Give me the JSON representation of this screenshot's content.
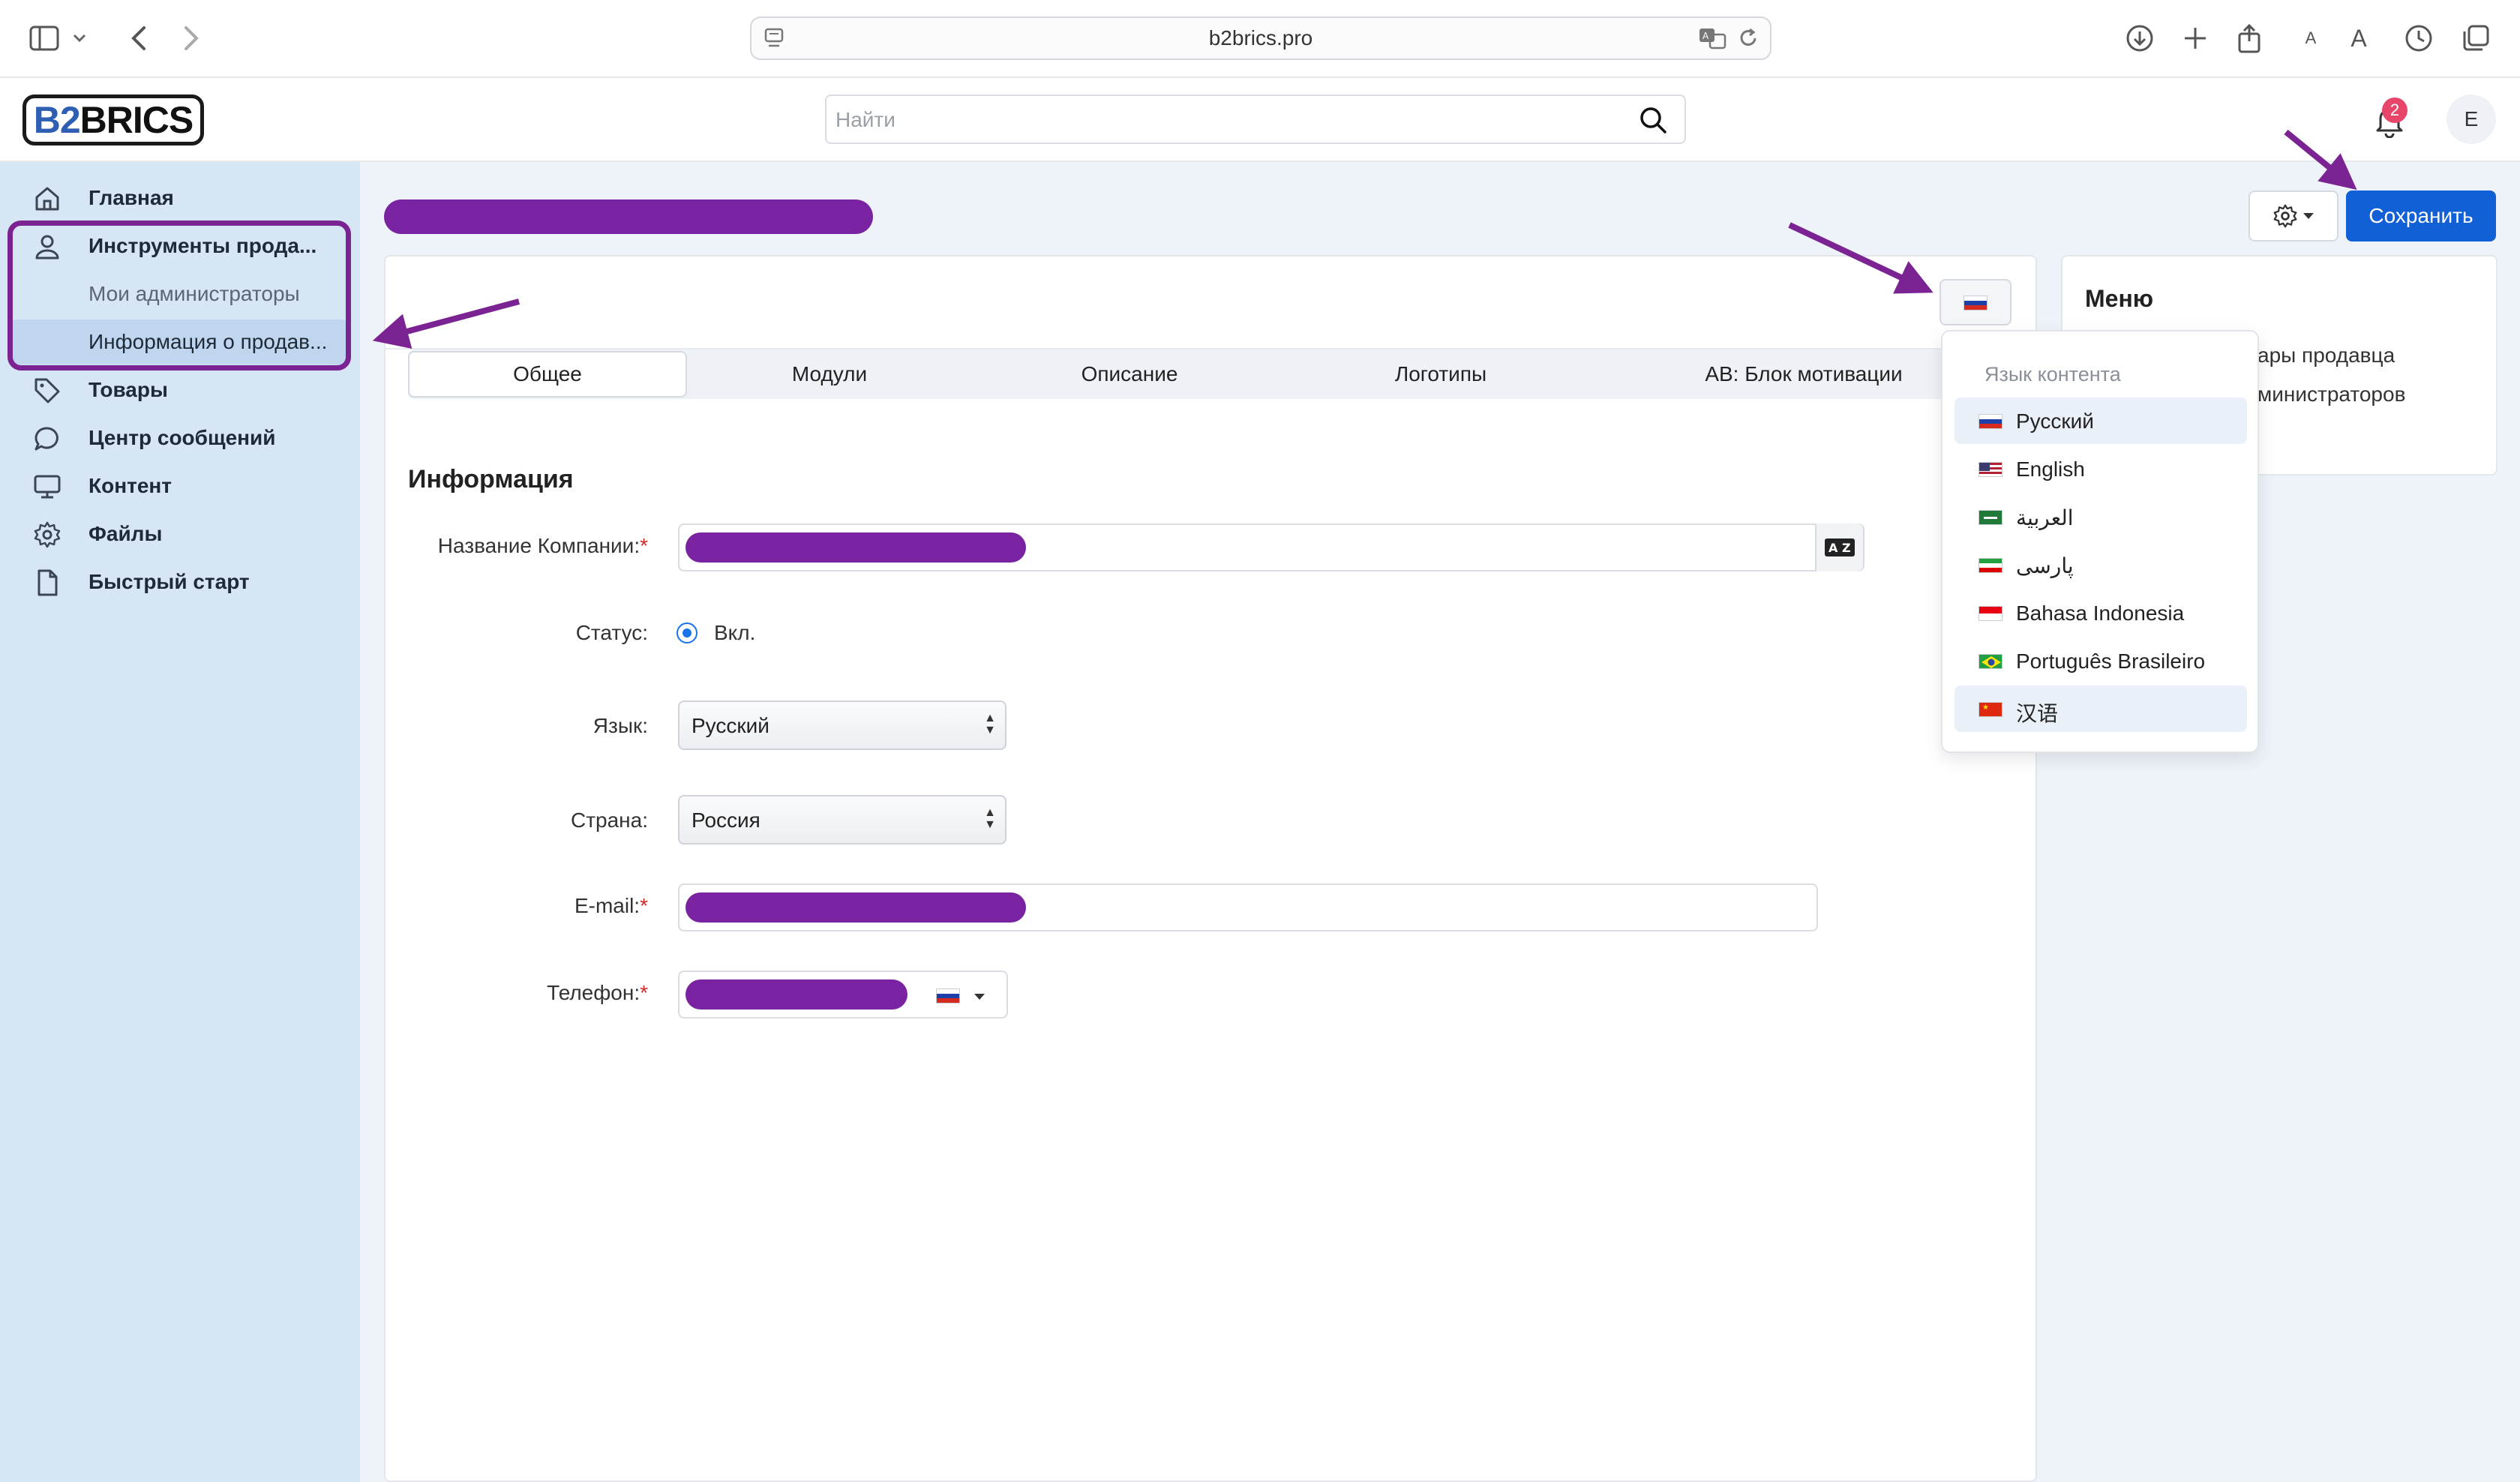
{
  "browser": {
    "url": "b2brics.pro",
    "font_small": "A",
    "font_large": "A"
  },
  "header": {
    "logo_b2": "B2",
    "logo_brics": "BRICS",
    "search_placeholder": "Найти",
    "notification_count": "2",
    "avatar_initial": "E"
  },
  "sidebar": {
    "items": [
      {
        "label": "Главная",
        "icon": "home-icon"
      },
      {
        "label": "Инструменты прода...",
        "icon": "user-icon"
      },
      {
        "label": "Мои администраторы"
      },
      {
        "label": "Информация о продав..."
      },
      {
        "label": "Товары",
        "icon": "tag-icon"
      },
      {
        "label": "Центр сообщений",
        "icon": "chat-icon"
      },
      {
        "label": "Контент",
        "icon": "monitor-icon"
      },
      {
        "label": "Файлы",
        "icon": "gear-icon"
      },
      {
        "label": "Быстрый старт",
        "icon": "file-icon"
      }
    ]
  },
  "toolbar": {
    "save_label": "Сохранить"
  },
  "tabs": [
    {
      "label": "Общее",
      "active": true
    },
    {
      "label": "Модули"
    },
    {
      "label": "Описание"
    },
    {
      "label": "Логотипы"
    },
    {
      "label": "AB: Блок мотивации"
    }
  ],
  "form": {
    "section_title": "Информация",
    "company_label": "Название Компании:",
    "status_label": "Статус:",
    "status_value": "Вкл.",
    "language_label": "Язык:",
    "language_value": "Русский",
    "country_label": "Страна:",
    "country_value": "Россия",
    "email_label": "E-mail:",
    "phone_label": "Телефон:",
    "required_mark": "*"
  },
  "language_dropdown": {
    "header": "Язык контента",
    "items": [
      {
        "label": "Русский",
        "flag": "ru",
        "selected": true
      },
      {
        "label": "English",
        "flag": "us"
      },
      {
        "label": "العربية",
        "flag": "sa"
      },
      {
        "label": "پارسی",
        "flag": "ir"
      },
      {
        "label": "Bahasa Indonesia",
        "flag": "id"
      },
      {
        "label": "Português Brasileiro",
        "flag": "br"
      },
      {
        "label": "汉语",
        "flag": "cn",
        "hovered": true
      }
    ]
  },
  "menu_card": {
    "title": "Меню",
    "link_1": "ары продавца",
    "link_2": "министраторов"
  },
  "colors": {
    "accent": "#1160d6",
    "sidebar_bg": "#d6e6f5",
    "annotation": "#7b2392",
    "redaction": "#7a23a2"
  }
}
